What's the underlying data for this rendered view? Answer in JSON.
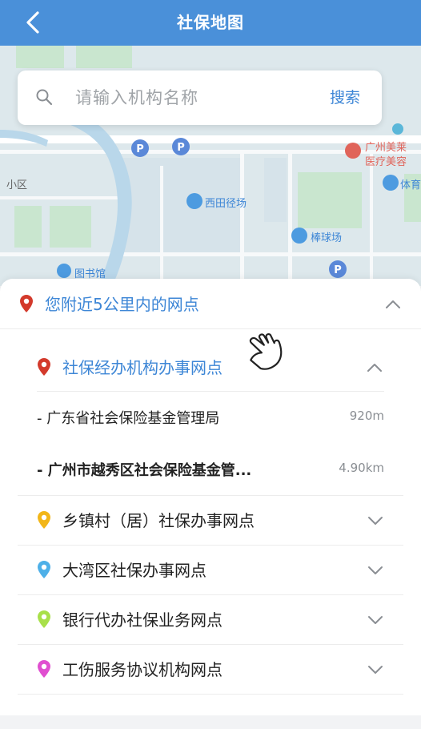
{
  "header": {
    "title": "社保地图"
  },
  "search": {
    "placeholder": "请输入机构名称",
    "button": "搜索"
  },
  "map": {
    "labels": {
      "xitian": "西田径场",
      "bangqiu": "棒球场",
      "library": "图书馆",
      "district": "小区",
      "tiyu": "体育",
      "meilai1": "广州美莱",
      "meilai2": "医疗美容"
    }
  },
  "panel": {
    "nearby_title": "您附近5公里内的网点",
    "groups": [
      {
        "label": "社保经办机构办事网点",
        "color": "#d33a2c",
        "expanded": true,
        "items": [
          {
            "name": "- 广东省社会保险基金管理局",
            "distance": "920m"
          },
          {
            "name": "- 广州市越秀区社会保险基金管...",
            "distance": "4.90km"
          }
        ]
      },
      {
        "label": "乡镇村（居）社保办事网点",
        "color": "#f2b619",
        "expanded": false
      },
      {
        "label": "大湾区社保办事网点",
        "color": "#4eb0e8",
        "expanded": false
      },
      {
        "label": "银行代办社保业务网点",
        "color": "#a8e04a",
        "expanded": false
      },
      {
        "label": "工伤服务协议机构网点",
        "color": "#e04fd0",
        "expanded": false
      }
    ]
  },
  "colors": {
    "header": "#4a90d9",
    "accent": "#3d86d6",
    "nearby_pin": "#d33a2c"
  },
  "icons": [
    "back-arrow-icon",
    "search-icon",
    "location-pin-icon",
    "chevron-up-icon",
    "chevron-down-icon",
    "hand-pointer-icon",
    "parking-icon"
  ]
}
